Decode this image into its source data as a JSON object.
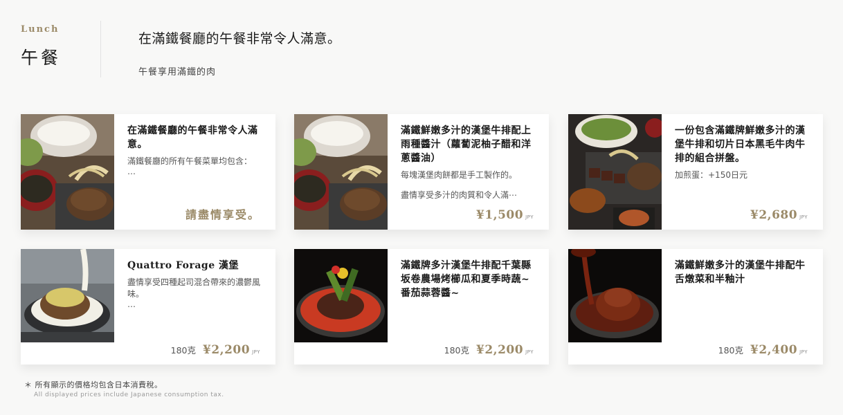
{
  "header": {
    "kicker": "Lunch",
    "title": "午餐",
    "headline": "在滿鐵餐廳的午餐非常令人滿意。",
    "subline": "午餐享用滿鐵的肉"
  },
  "items": [
    {
      "title": "在滿鐵餐廳的午餐非常令人滿意。",
      "desc": "滿鐵餐廳的所有午餐菜單均包含：",
      "ellipsis": "…",
      "tagline": "請盡情享受。",
      "photo_icon": "rice-soup-hamburg-set-photo"
    },
    {
      "title": "滿鐵鮮嫩多汁的漢堡牛排配上雨種醬汁（蘿蔔泥柚子醋和洋蔥醬油）",
      "desc": "每塊漢堡肉餅都是手工製作的。",
      "desc2": "盡情享受多汁的肉質和令人滿⋯",
      "price": "¥1,500",
      "currency": "JPY",
      "photo_icon": "rice-soup-hamburg-set-photo"
    },
    {
      "title": "一份包含滿鐵牌鮮嫩多汁的漢堡牛排和切片日本黑毛牛肉牛排的組合拼盤。",
      "desc": "加煎蛋：+150日元",
      "price": "¥2,680",
      "currency": "JPY",
      "photo_icon": "steak-combo-platter-photo"
    },
    {
      "title": "Quattro Forage 漢堡",
      "desc": "盡情享受四種起司混合帶來的濃鬱風味。",
      "ellipsis": "…",
      "weight": "180克",
      "price": "¥2,200",
      "currency": "JPY",
      "photo_icon": "cheese-hamburg-photo"
    },
    {
      "title": "滿鐵牌多汁漢堡牛排配千葉縣坂卷農場烤櫛瓜和夏季時蔬~番茄蒜蓉醬~",
      "weight": "180克",
      "price": "¥2,200",
      "currency": "JPY",
      "photo_icon": "tomato-hamburg-photo"
    },
    {
      "title": "滿鐵鮮嫩多汁的漢堡牛排配牛舌燉菜和半釉汁",
      "weight": "180克",
      "price": "¥2,400",
      "currency": "JPY",
      "photo_icon": "stew-hamburg-photo"
    }
  ],
  "footer": {
    "note_ja": "＊ 所有顯示的價格均包含日本消費稅。",
    "note_en": "All displayed prices include Japanese consumption tax."
  },
  "colors": {
    "background": "#f8f8f7",
    "accent_gold": "#9b8a68",
    "card": "#ffffff",
    "text": "#1b1b1b"
  }
}
